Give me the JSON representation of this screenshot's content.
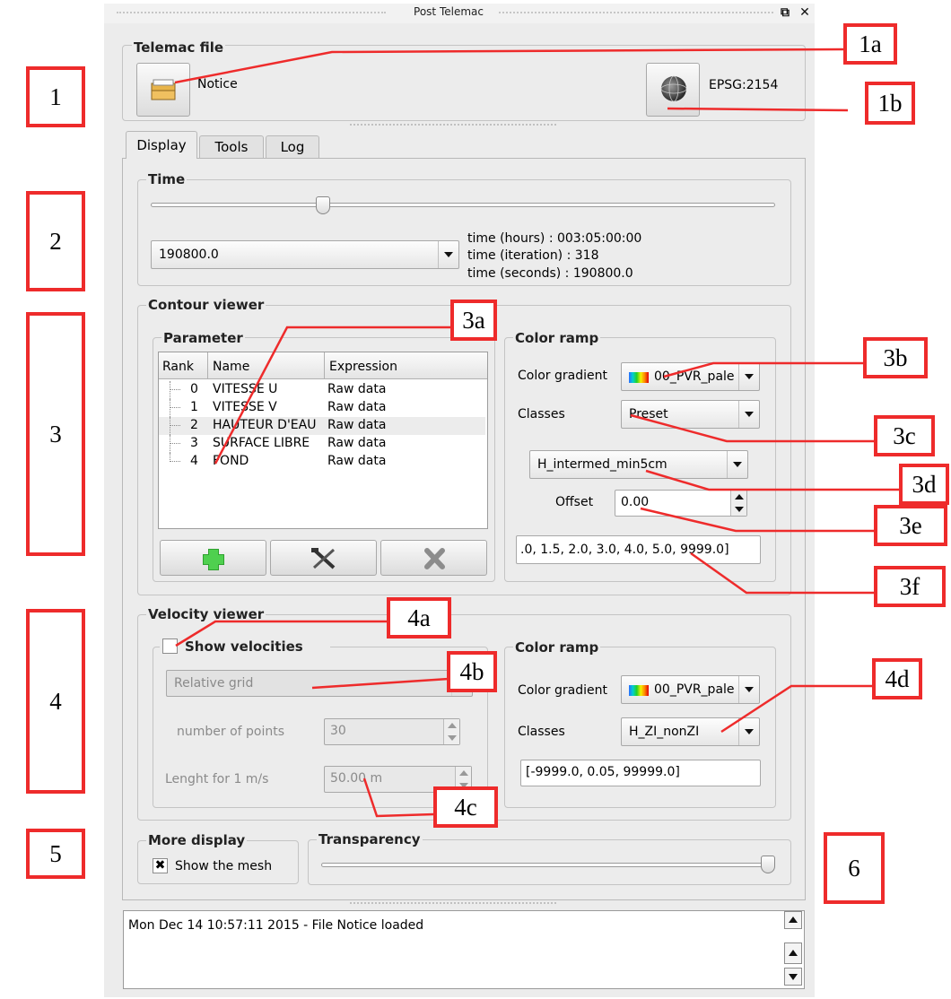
{
  "window": {
    "title": "Post Telemac"
  },
  "telemac_file": {
    "group_title": "Telemac file",
    "file_name": "Notice",
    "crs": "EPSG:2154",
    "open_icon": "folder-open-icon",
    "crs_icon": "globe-icon"
  },
  "tabs": [
    {
      "label": "Display"
    },
    {
      "label": "Tools"
    },
    {
      "label": "Log"
    }
  ],
  "time": {
    "group_title": "Time",
    "slider_fraction": 0.27,
    "selected": "190800.0",
    "hours": "time (hours) : 003:05:00:00",
    "iteration": "time (iteration) : 318",
    "seconds": "time (seconds) : 190800.0"
  },
  "contour": {
    "group_title": "Contour viewer",
    "parameter_title": "Parameter",
    "columns": [
      "Rank",
      "Name",
      "Expression"
    ],
    "rows": [
      {
        "rank": "0",
        "name": "VITESSE U",
        "expr": "Raw data"
      },
      {
        "rank": "1",
        "name": "VITESSE V",
        "expr": "Raw data"
      },
      {
        "rank": "2",
        "name": "HAUTEUR D'EAU",
        "expr": "Raw data"
      },
      {
        "rank": "3",
        "name": "SURFACE LIBRE",
        "expr": "Raw data"
      },
      {
        "rank": "4",
        "name": "FOND",
        "expr": "Raw data"
      }
    ],
    "selected_row": 2,
    "buttons": [
      "add-icon",
      "tools-icon",
      "delete-icon"
    ],
    "color_ramp_title": "Color ramp",
    "color_gradient_label": "Color gradient",
    "color_gradient_value": "00_PVR_palе",
    "classes_label": "Classes",
    "classes_value": "Preset",
    "preset_value": "H_intermed_min5cm",
    "offset_label": "Offset",
    "offset_value": "0.00",
    "levels": ".0, 1.5, 2.0, 3.0, 4.0, 5.0, 9999.0]"
  },
  "velocity": {
    "group_title": "Velocity viewer",
    "show_label": "Show velocities",
    "show_checked": false,
    "grid_type": "Relative grid",
    "points_label": "number of points",
    "points_value": "30",
    "length_label": "Lenght for 1 m/s",
    "length_value": "50.00 m",
    "color_ramp_title": "Color ramp",
    "color_gradient_label": "Color gradient",
    "color_gradient_value": "00_PVR_palе",
    "classes_label": "Classes",
    "classes_value": "H_ZI_nonZI",
    "levels": "[-9999.0, 0.05, 99999.0]"
  },
  "more_display": {
    "group_title": "More display",
    "show_mesh_label": "Show the mesh",
    "show_mesh_checked": true
  },
  "transparency": {
    "group_title": "Transparency",
    "slider_fraction": 1.0
  },
  "log": {
    "text": "Mon Dec 14 10:57:11 2015 - File Notice loaded"
  },
  "annotations": {
    "box_1": "1",
    "box_2": "2",
    "box_3": "3",
    "box_4": "4",
    "box_5": "5",
    "box_6": "6",
    "c_1a": "1a",
    "c_1b": "1b",
    "c_3a": "3a",
    "c_3b": "3b",
    "c_3c": "3c",
    "c_3d": "3d",
    "c_3e": "3e",
    "c_3f": "3f",
    "c_4a": "4a",
    "c_4b": "4b",
    "c_4c": "4c",
    "c_4d": "4d",
    "color": "#ee2b2b"
  }
}
